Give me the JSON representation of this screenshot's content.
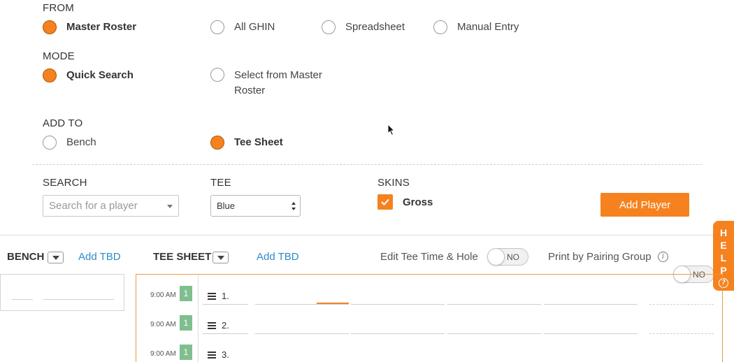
{
  "from": {
    "label": "FROM",
    "options": [
      {
        "label": "Master Roster",
        "selected": true
      },
      {
        "label": "All GHIN",
        "selected": false
      },
      {
        "label": "Spreadsheet",
        "selected": false
      },
      {
        "label": "Manual Entry",
        "selected": false
      }
    ]
  },
  "mode": {
    "label": "MODE",
    "options": [
      {
        "label": "Quick Search",
        "selected": true
      },
      {
        "label_line1": "Select from Master",
        "label_line2": "Roster",
        "selected": false
      }
    ]
  },
  "add_to": {
    "label": "ADD TO",
    "options": [
      {
        "label": "Bench",
        "selected": false
      },
      {
        "label": "Tee Sheet",
        "selected": true
      }
    ]
  },
  "search": {
    "label": "SEARCH",
    "placeholder": "Search for a player"
  },
  "tee": {
    "label": "TEE",
    "value": "Blue"
  },
  "skins": {
    "label": "SKINS",
    "option_label": "Gross",
    "checked": true
  },
  "add_player_label": "Add Player",
  "bench": {
    "title": "BENCH",
    "add_tbd": "Add TBD"
  },
  "tee_sheet": {
    "title": "TEE SHEET",
    "add_tbd": "Add TBD",
    "edit_tee_time_label": "Edit Tee Time & Hole",
    "edit_tee_time_toggle": "NO",
    "print_pairing_label": "Print by Pairing Group",
    "print_pairing_toggle": "NO",
    "rows": [
      {
        "time": "9:00 AM",
        "hole": "1",
        "number": "1."
      },
      {
        "time": "9:00 AM",
        "hole": "1",
        "number": "2."
      },
      {
        "time": "9:00 AM",
        "hole": "1",
        "number": "3."
      }
    ]
  },
  "help": {
    "letters": [
      "H",
      "E",
      "L",
      "P"
    ],
    "icon": "question-circle-icon"
  },
  "colors": {
    "accent": "#f5821f",
    "link": "#2e8bc9",
    "hole_badge": "#7fbf8f"
  }
}
